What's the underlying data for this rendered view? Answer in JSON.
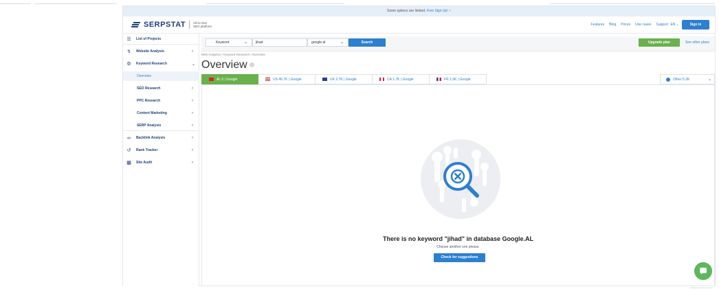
{
  "notice": {
    "text": "Some options are limited.",
    "link": "Free Sign Up!",
    "close": "×"
  },
  "header": {
    "logo": "SERPSTAT",
    "logo_sub_1": "All-in-One",
    "logo_sub_2": "SEO platform",
    "nav": [
      "Features",
      "Blog",
      "Prices",
      "Use cases",
      "Support"
    ],
    "lang": "EN",
    "signin": "Sign in"
  },
  "sidebar": {
    "items": [
      {
        "label": "List of Projects",
        "icon": "list-icon"
      },
      {
        "label": "Website Analysis",
        "icon": "website-analysis-icon"
      },
      {
        "label": "Keyword Research",
        "icon": "key-icon"
      },
      {
        "label": "Overview"
      },
      {
        "label": "SEO Research"
      },
      {
        "label": "PPC Research"
      },
      {
        "label": "Content Marketing"
      },
      {
        "label": "SERP Analysis"
      },
      {
        "label": "Backlink Analysis",
        "icon": "link-icon"
      },
      {
        "label": "Rank Tracker",
        "icon": "rank-tracker-icon"
      },
      {
        "label": "Site Audit",
        "icon": "bar-chart-icon"
      }
    ]
  },
  "search": {
    "type": "Keyword",
    "query": "jihad",
    "db": "google.al",
    "button": "Search",
    "upgrade": "Upgrade plan",
    "other_plans": "See other plans"
  },
  "breadcrumb": "Web Analytics / Keyword Research / Overview",
  "title": "Overview",
  "tabs": [
    {
      "label": "AL 0 | Google",
      "flag": "AL"
    },
    {
      "label": "US 40.7K | Google",
      "flag": "US"
    },
    {
      "label": "UK 2.7K | Google",
      "flag": "UK"
    },
    {
      "label": "CA 1.7K | Google",
      "flag": "CA"
    },
    {
      "label": "FR 1.5K | Google",
      "flag": "FR"
    }
  ],
  "other_tab": "Other 5.2K",
  "empty": {
    "title": "There is no keyword \"jihad\" in database Google.AL",
    "subtitle": "Choose another one please.",
    "button": "Check for suggestions"
  },
  "colors": {
    "accent": "#2d7fd0",
    "green": "#6ab04c",
    "brand": "#1f3e7a"
  }
}
